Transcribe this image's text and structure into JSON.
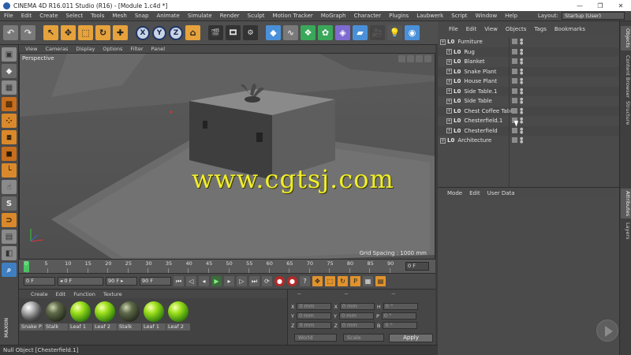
{
  "window": {
    "title": "CINEMA 4D R16.011 Studio (R16) - [Module 1.c4d *]",
    "minimize": "—",
    "maximize": "❐",
    "close": "✕"
  },
  "menu": [
    "File",
    "Edit",
    "Create",
    "Select",
    "Tools",
    "Mesh",
    "Snap",
    "Animate",
    "Simulate",
    "Render",
    "Sculpt",
    "Motion Tracker",
    "MoGraph",
    "Character",
    "Plugins",
    "Laubwerk",
    "Script",
    "Window",
    "Help"
  ],
  "layout": {
    "label": "Layout:",
    "value": "Startup (User)"
  },
  "viewport": {
    "menus": [
      "View",
      "Cameras",
      "Display",
      "Options",
      "Filter",
      "Panel"
    ],
    "label": "Perspective",
    "grid_spacing": "Grid Spacing : 1000 mm",
    "watermark": "www.cgtsj.com"
  },
  "timeline": {
    "ticks": [
      "0",
      "5",
      "10",
      "15",
      "20",
      "25",
      "30",
      "35",
      "40",
      "45",
      "50",
      "55",
      "60",
      "65",
      "70",
      "75",
      "80",
      "85",
      "90"
    ],
    "end_frame": "0 F"
  },
  "transport": {
    "start": "0 F",
    "current": "◂ 0 F",
    "preview_end": "90 F ▸",
    "end": "90 F"
  },
  "material_manager": {
    "menus": [
      "Create",
      "Edit",
      "Function",
      "Texture"
    ],
    "materials": [
      {
        "name": "Snake P",
        "style": "stripe"
      },
      {
        "name": "Stalk",
        "style": "dark"
      },
      {
        "name": "Leaf 1",
        "style": "green"
      },
      {
        "name": "Leaf 2",
        "style": "green"
      },
      {
        "name": "Stalk",
        "style": "dark"
      },
      {
        "name": "Leaf 1",
        "style": "green"
      },
      {
        "name": "Leaf 2",
        "style": "green"
      }
    ]
  },
  "coordinates": {
    "headers": [
      "--",
      "--",
      "--"
    ],
    "rows": [
      {
        "a": "X",
        "av": "0 mm",
        "b": "X",
        "bv": "0 mm",
        "c": "H",
        "cv": "0 °"
      },
      {
        "a": "Y",
        "av": "0 mm",
        "b": "Y",
        "bv": "0 mm",
        "c": "P",
        "cv": "0 °"
      },
      {
        "a": "Z",
        "av": "0 mm",
        "b": "Z",
        "bv": "0 mm",
        "c": "B",
        "cv": "0 °"
      }
    ],
    "space": "World",
    "mode": "Scale",
    "apply": "Apply"
  },
  "status": "Null Object [Chesterfield.1]",
  "object_manager": {
    "menus": [
      "File",
      "Edit",
      "View",
      "Objects",
      "Tags",
      "Bookmarks"
    ],
    "objects": [
      {
        "name": "Furniture",
        "indent": 0
      },
      {
        "name": "Rug",
        "indent": 1
      },
      {
        "name": "Blanket",
        "indent": 1
      },
      {
        "name": "Snake Plant",
        "indent": 1
      },
      {
        "name": "House Plant",
        "indent": 1
      },
      {
        "name": "Side Table.1",
        "indent": 1
      },
      {
        "name": "Side Table",
        "indent": 1
      },
      {
        "name": "Chest Coffee Table",
        "indent": 1
      },
      {
        "name": "Chesterfield.1",
        "indent": 1
      },
      {
        "name": "Chesterfield",
        "indent": 1
      },
      {
        "name": "Architecture",
        "indent": 0
      }
    ]
  },
  "attribute_manager": {
    "menus": [
      "Mode",
      "Edit",
      "User Data"
    ]
  },
  "right_tabs": [
    "Objects",
    "Content Browser",
    "Structure",
    "Attributes",
    "Layers"
  ],
  "colors": {
    "accent_green": "#48c760",
    "watermark_yellow": "#f1ee2a",
    "play_green": "#3d6b3d"
  }
}
